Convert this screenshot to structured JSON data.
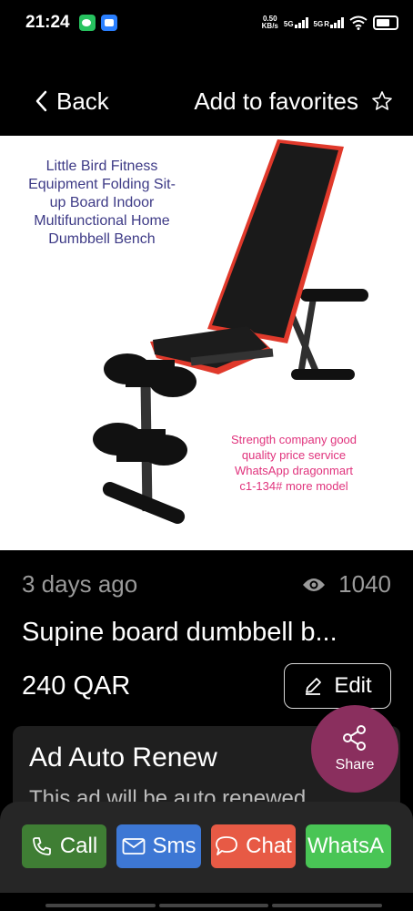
{
  "status_bar": {
    "time": "21:24",
    "net_speed_value": "0.50",
    "net_speed_unit": "KB/s",
    "sim1": "5G",
    "sim2": "5G",
    "sim2_roaming": "R",
    "battery_level": 0.7
  },
  "header": {
    "back_label": "Back",
    "favorites_label": "Add to favorites"
  },
  "product_image": {
    "caption_left": "Little Bird Fitness Equipment Folding Sit-up Board Indoor Multifunctional Home Dumbbell Bench",
    "caption_right": "Strength company good quality price service WhatsApp dragonmart c1-134# more model"
  },
  "listing": {
    "posted": "3 days ago",
    "views": "1040",
    "title": "Supine board dumbbell b...",
    "price": "240 QAR",
    "edit_label": "Edit",
    "share_label": "Share"
  },
  "renew": {
    "title": "Ad Auto Renew",
    "description": "This ad will be auto renewed"
  },
  "actions": {
    "call": "Call",
    "sms": "Sms",
    "chat": "Chat",
    "whatsapp": "WhatsA"
  },
  "colors": {
    "call": "#3f7e34",
    "sms": "#3d77d4",
    "chat": "#e75a45",
    "whatsapp": "#49c555",
    "share": "#8a2f5e",
    "caption_left": "#3d3a86",
    "caption_right": "#e0327c"
  }
}
